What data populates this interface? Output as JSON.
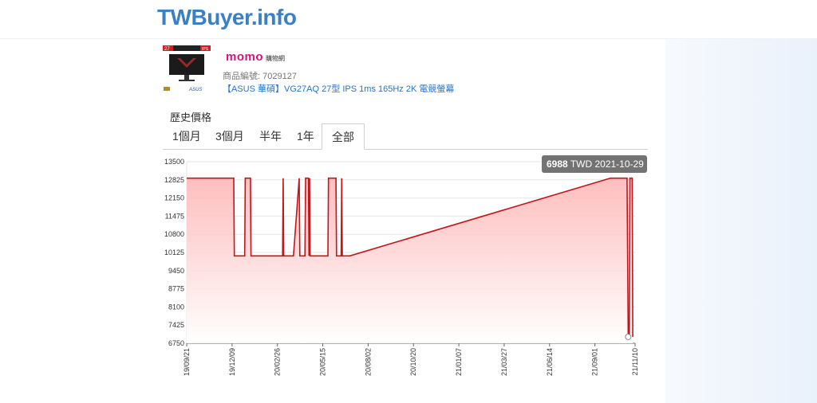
{
  "site": {
    "logo": "TWBuyer.info"
  },
  "product": {
    "store_name": "momo",
    "store_sub": "購物網",
    "id_text": "商品編號: 7029127",
    "title": "【ASUS 華碩】VG27AQ 27型 IPS 1ms 165Hz 2K 電競螢幕",
    "thumb_badge_size": "27",
    "thumb_badge_panel": "IPS",
    "thumb_brand": "ASUS"
  },
  "history": {
    "section_title": "歷史價格",
    "tabs": [
      {
        "label": "1個月",
        "active": false
      },
      {
        "label": "3個月",
        "active": false
      },
      {
        "label": "半年",
        "active": false
      },
      {
        "label": "1年",
        "active": false
      },
      {
        "label": "全部",
        "active": true
      }
    ]
  },
  "colors": {
    "line": "#c0161c",
    "fill_top": "#ffb3b3",
    "tooltip_bg": "#6b6b6b",
    "accent_blue": "#3b7fc4"
  },
  "chart_data": {
    "type": "area",
    "title": "",
    "xlabel": "",
    "ylabel": "",
    "ylim": [
      6750,
      13500
    ],
    "y_ticks": [
      "13500",
      "12825",
      "12150",
      "11475",
      "10800",
      "10125",
      "9450",
      "8775",
      "8100",
      "7425",
      "6750"
    ],
    "xlim": [
      "2019-09-21",
      "2021-11-10"
    ],
    "x_ticks": [
      {
        "date": "2019-09-21",
        "label": "19/09/21"
      },
      {
        "date": "2019-12-09",
        "label": "19/12/09"
      },
      {
        "date": "2020-02-26",
        "label": "20/02/26"
      },
      {
        "date": "2020-05-15",
        "label": "20/05/15"
      },
      {
        "date": "2020-08-02",
        "label": "20/08/02"
      },
      {
        "date": "2020-10-20",
        "label": "20/10/20"
      },
      {
        "date": "2021-01-07",
        "label": "21/01/07"
      },
      {
        "date": "2021-03-27",
        "label": "21/03/27"
      },
      {
        "date": "2021-06-14",
        "label": "21/06/14"
      },
      {
        "date": "2021-09-01",
        "label": "21/09/01"
      },
      {
        "date": "2021-11-10",
        "label": "21/11/10"
      }
    ],
    "grid": true,
    "series": [
      {
        "name": "",
        "points": [
          {
            "x": "2019-09-21",
            "y": 12888
          },
          {
            "x": "2019-12-12",
            "y": 12888
          },
          {
            "x": "2019-12-13",
            "y": 9999
          },
          {
            "x": "2019-12-31",
            "y": 9999
          },
          {
            "x": "2020-01-01",
            "y": 12888
          },
          {
            "x": "2020-01-10",
            "y": 12888
          },
          {
            "x": "2020-01-11",
            "y": 9999
          },
          {
            "x": "2020-03-06",
            "y": 9999
          },
          {
            "x": "2020-03-07",
            "y": 12888
          },
          {
            "x": "2020-03-08",
            "y": 9999
          },
          {
            "x": "2020-03-25",
            "y": 9999
          },
          {
            "x": "2020-04-04",
            "y": 12888
          },
          {
            "x": "2020-04-05",
            "y": 9999
          },
          {
            "x": "2020-04-14",
            "y": 9999
          },
          {
            "x": "2020-04-15",
            "y": 12888
          },
          {
            "x": "2020-04-20",
            "y": 12888
          },
          {
            "x": "2020-04-21",
            "y": 9999
          },
          {
            "x": "2020-04-22",
            "y": 12888
          },
          {
            "x": "2020-04-23",
            "y": 9999
          },
          {
            "x": "2020-05-24",
            "y": 9999
          },
          {
            "x": "2020-05-25",
            "y": 12888
          },
          {
            "x": "2020-06-07",
            "y": 12888
          },
          {
            "x": "2020-06-08",
            "y": 9999
          },
          {
            "x": "2020-06-16",
            "y": 9999
          },
          {
            "x": "2020-06-17",
            "y": 12888
          },
          {
            "x": "2020-06-18",
            "y": 9999
          },
          {
            "x": "2020-07-01",
            "y": 9999
          },
          {
            "x": "2021-09-28",
            "y": 12888
          },
          {
            "x": "2021-10-27",
            "y": 12888
          },
          {
            "x": "2021-10-29",
            "y": 6988
          },
          {
            "x": "2021-10-31",
            "y": 6988
          },
          {
            "x": "2021-11-01",
            "y": 12888
          },
          {
            "x": "2021-11-05",
            "y": 12888
          },
          {
            "x": "2021-11-06",
            "y": 6988
          }
        ]
      }
    ],
    "tooltip": {
      "value": "6988",
      "unit": "TWD",
      "date": "2021-10-29"
    }
  }
}
